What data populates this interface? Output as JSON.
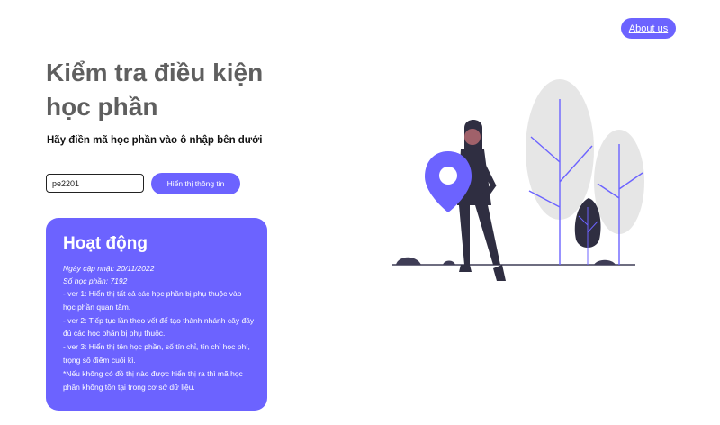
{
  "header": {
    "about_label": "About us"
  },
  "hero": {
    "title": "Kiểm tra điều kiện học phần",
    "subtitle": "Hãy điền mã học phần vào ô nhập bên dưới"
  },
  "search": {
    "value": "pe2201",
    "button_label": "Hiển thị thông tin"
  },
  "activity": {
    "heading": "Hoạt động",
    "updated": "Ngày cập nhật: 20/11/2022",
    "count": "Số học phần: 7192",
    "lines": [
      "- ver 1: Hiển thị tất cả các học phần bị phụ thuộc vào học phần quan tâm.",
      "- ver 2: Tiếp tục lần theo vết để tạo thành nhánh cây đầy đủ các học phần bị phụ thuộc.",
      "- ver 3: Hiển thị tên học phần, số tín chỉ, tín chỉ học phí, trọng số điểm cuối kì.",
      "*Nếu không có đồ thị nào được hiển thị ra thì mã học phần không tồn tại trong cơ sở dữ liệu."
    ]
  },
  "colors": {
    "accent": "#6c63ff",
    "title": "#5f5f5f",
    "leaf": "#e6e6e6",
    "dark": "#2f2e41"
  }
}
